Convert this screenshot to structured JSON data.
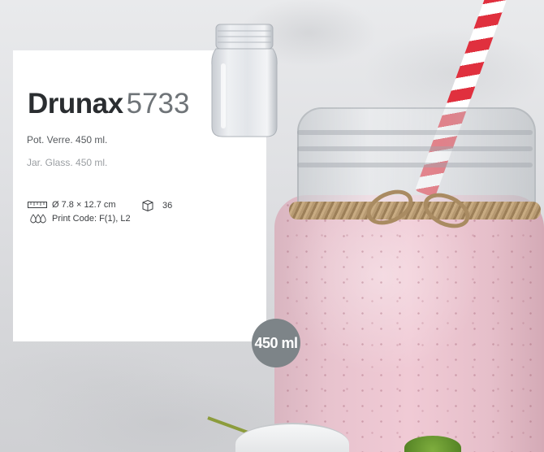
{
  "product": {
    "name": "Drunax",
    "code": "5733",
    "description_fr": "Pot. Verre. 450 ml.",
    "description_en": "Jar. Glass. 450 ml."
  },
  "specs": {
    "dimensions": "Ø 7.8 × 12.7 cm",
    "box_quantity": "36",
    "print_code": "Print Code: F(1), L2"
  },
  "icons": {
    "dimensions": "ruler-icon",
    "box_quantity": "box-icon",
    "print_code": "print-drops-icon"
  },
  "badge": {
    "capacity": "450 ml"
  },
  "colors": {
    "badge_bg": "#7d8488",
    "title": "#2a2d30",
    "code": "#6f7478",
    "straw_red": "#e0303e",
    "smoothie_pink": "#f0cad5"
  }
}
